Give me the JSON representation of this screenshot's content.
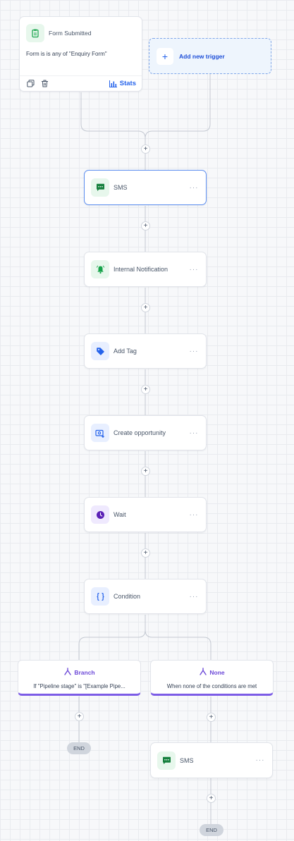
{
  "trigger": {
    "title": "Form Submitted",
    "description": "Form is is any of \"Enquiry Form\"",
    "stats_label": "Stats",
    "icon": "clipboard-icon"
  },
  "add_trigger": {
    "label": "Add new trigger"
  },
  "actions": [
    {
      "label": "SMS",
      "icon": "sms-icon",
      "color": "#16a34a"
    },
    {
      "label": "Internal Notification",
      "icon": "bell-icon",
      "color": "#16a34a"
    },
    {
      "label": "Add Tag",
      "icon": "tag-icon",
      "color": "#2563eb"
    },
    {
      "label": "Create opportunity",
      "icon": "opportunity-icon",
      "color": "#2563eb"
    },
    {
      "label": "Wait",
      "icon": "clock-icon",
      "color": "#6d28d9"
    },
    {
      "label": "Condition",
      "icon": "braces-icon",
      "color": "#2563eb"
    }
  ],
  "branches": [
    {
      "title": "Branch",
      "description": "If \"Pipeline stage\" is \"[Example Pipe..."
    },
    {
      "title": "None",
      "description": "When none of the conditions are met"
    }
  ],
  "none_branch_action": {
    "label": "SMS",
    "icon": "sms-icon"
  },
  "more_label": "···",
  "plus_label": "+",
  "end_label": "END",
  "colors": {
    "accent": "#2563eb",
    "branch": "#7c5ce6",
    "success": "#16a34a"
  }
}
